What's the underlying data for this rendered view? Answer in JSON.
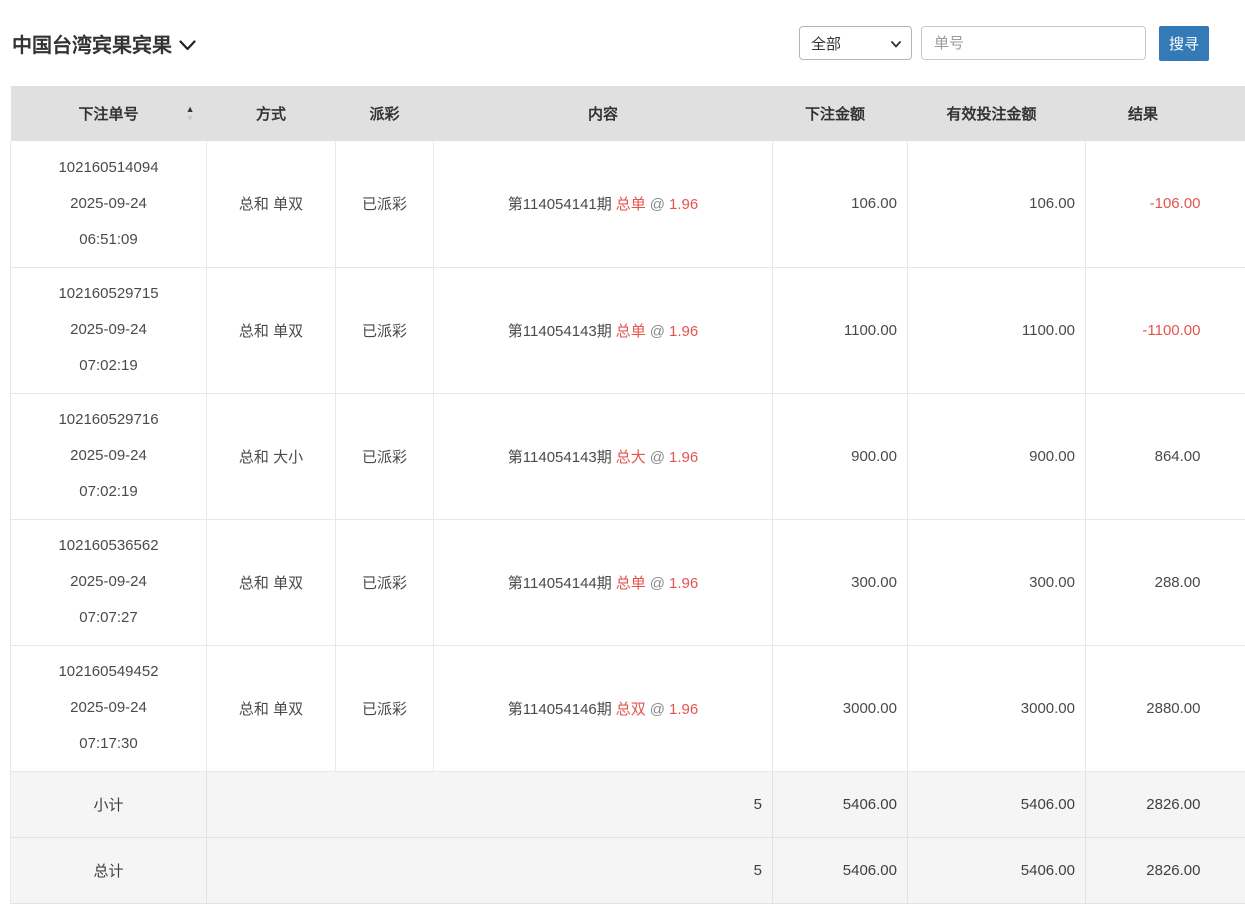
{
  "header": {
    "title": "中国台湾宾果宾果",
    "filter_selected": "全部",
    "search_placeholder": "单号",
    "search_button": "搜寻"
  },
  "icons": {
    "sort_asc": "▲",
    "sort_desc": "▼"
  },
  "colors": {
    "accent_blue": "#337ab7",
    "danger_red": "#e4544e",
    "header_bg": "#e0e0e0",
    "summary_bg": "#f5f5f5"
  },
  "table": {
    "columns": [
      "下注单号",
      "方式",
      "派彩",
      "内容",
      "下注金额",
      "有效投注金额",
      "结果"
    ],
    "rows": [
      {
        "order_no": "102160514094",
        "date": "2025-09-24",
        "time": "06:51:09",
        "method": "总和 单双",
        "payout": "已派彩",
        "content_prefix": "第114054141期",
        "content_bet": "总单",
        "content_at": "@",
        "content_odds": "1.96",
        "bet_amount": "106.00",
        "valid_amount": "106.00",
        "result": "-106.00"
      },
      {
        "order_no": "102160529715",
        "date": "2025-09-24",
        "time": "07:02:19",
        "method": "总和 单双",
        "payout": "已派彩",
        "content_prefix": "第114054143期",
        "content_bet": "总单",
        "content_at": "@",
        "content_odds": "1.96",
        "bet_amount": "1100.00",
        "valid_amount": "1100.00",
        "result": "-1100.00"
      },
      {
        "order_no": "102160529716",
        "date": "2025-09-24",
        "time": "07:02:19",
        "method": "总和 大小",
        "payout": "已派彩",
        "content_prefix": "第114054143期",
        "content_bet": "总大",
        "content_at": "@",
        "content_odds": "1.96",
        "bet_amount": "900.00",
        "valid_amount": "900.00",
        "result": "864.00"
      },
      {
        "order_no": "102160536562",
        "date": "2025-09-24",
        "time": "07:07:27",
        "method": "总和 单双",
        "payout": "已派彩",
        "content_prefix": "第114054144期",
        "content_bet": "总单",
        "content_at": "@",
        "content_odds": "1.96",
        "bet_amount": "300.00",
        "valid_amount": "300.00",
        "result": "288.00"
      },
      {
        "order_no": "102160549452",
        "date": "2025-09-24",
        "time": "07:17:30",
        "method": "总和 单双",
        "payout": "已派彩",
        "content_prefix": "第114054146期",
        "content_bet": "总双",
        "content_at": "@",
        "content_odds": "1.96",
        "bet_amount": "3000.00",
        "valid_amount": "3000.00",
        "result": "2880.00"
      }
    ],
    "subtotal": {
      "label": "小计",
      "count": "5",
      "bet_amount": "5406.00",
      "valid_amount": "5406.00",
      "result": "2826.00"
    },
    "total": {
      "label": "总计",
      "count": "5",
      "bet_amount": "5406.00",
      "valid_amount": "5406.00",
      "result": "2826.00"
    }
  }
}
